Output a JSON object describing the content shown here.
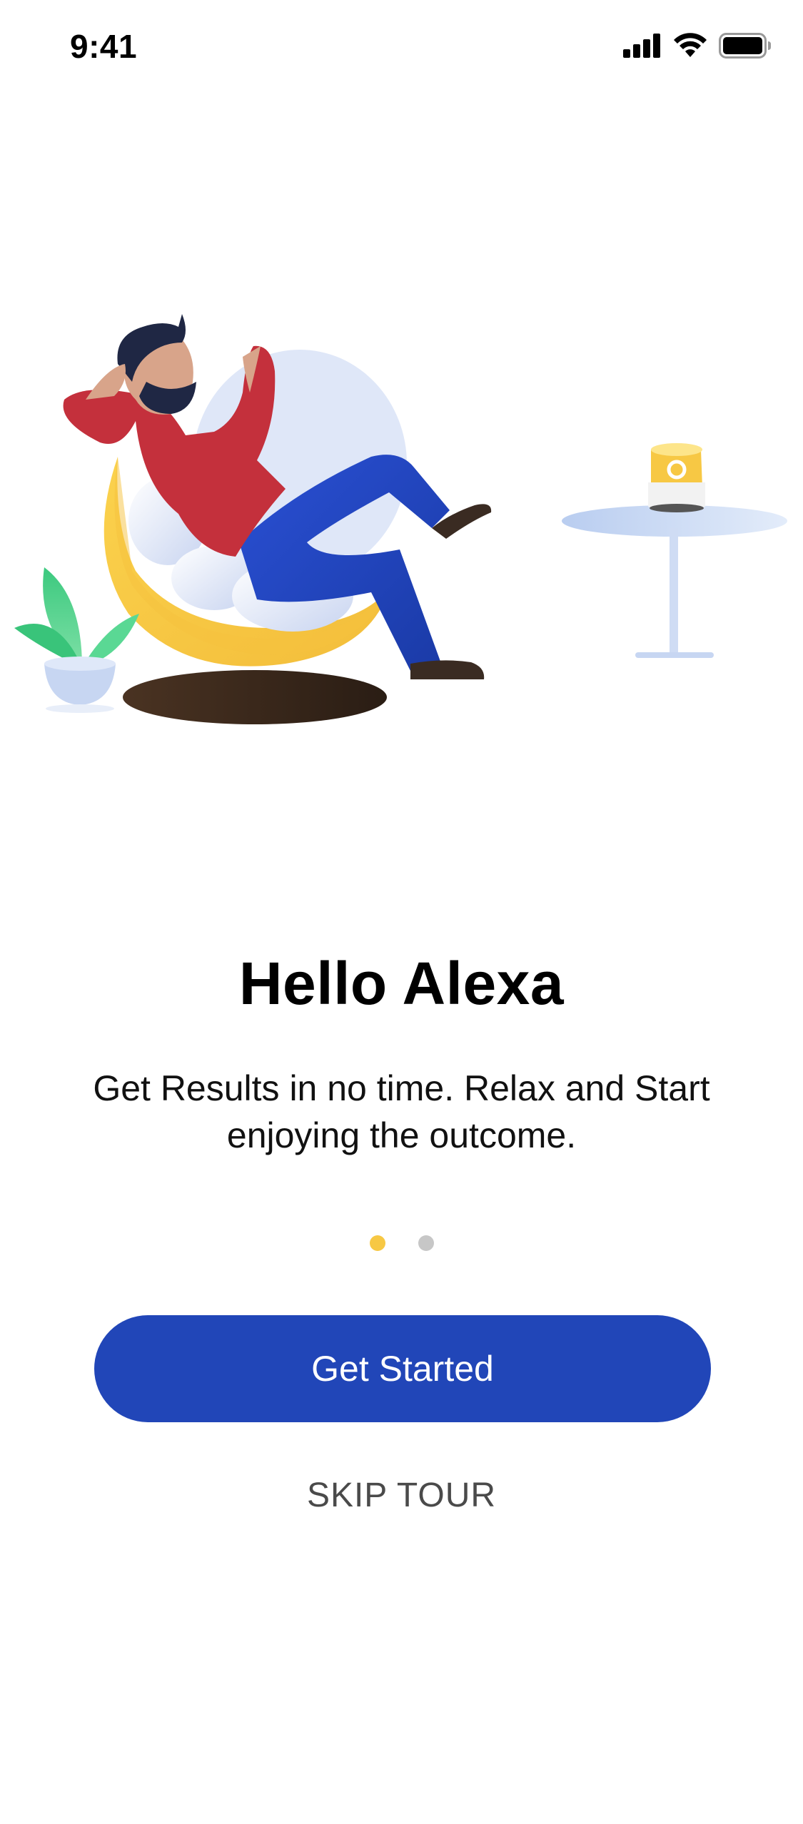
{
  "status_bar": {
    "time": "9:41",
    "icons": [
      "cellular-signal-icon",
      "wifi-icon",
      "battery-icon"
    ]
  },
  "illustration": {
    "name": "man-relaxing-with-smart-speaker",
    "speaker_accent_color": "#f7c844"
  },
  "onboarding": {
    "title": "Hello Alexa",
    "subtitle": "Get Results in no time. Relax and Start enjoying the outcome.",
    "pagination": {
      "total": 2,
      "active_index": 0
    }
  },
  "actions": {
    "primary_label": "Get Started",
    "secondary_label": "SKIP TOUR"
  },
  "colors": {
    "primary": "#2146b8",
    "accent": "#f7c844",
    "dot_inactive": "#c7c7c7",
    "text_secondary": "#4a4a4a"
  }
}
